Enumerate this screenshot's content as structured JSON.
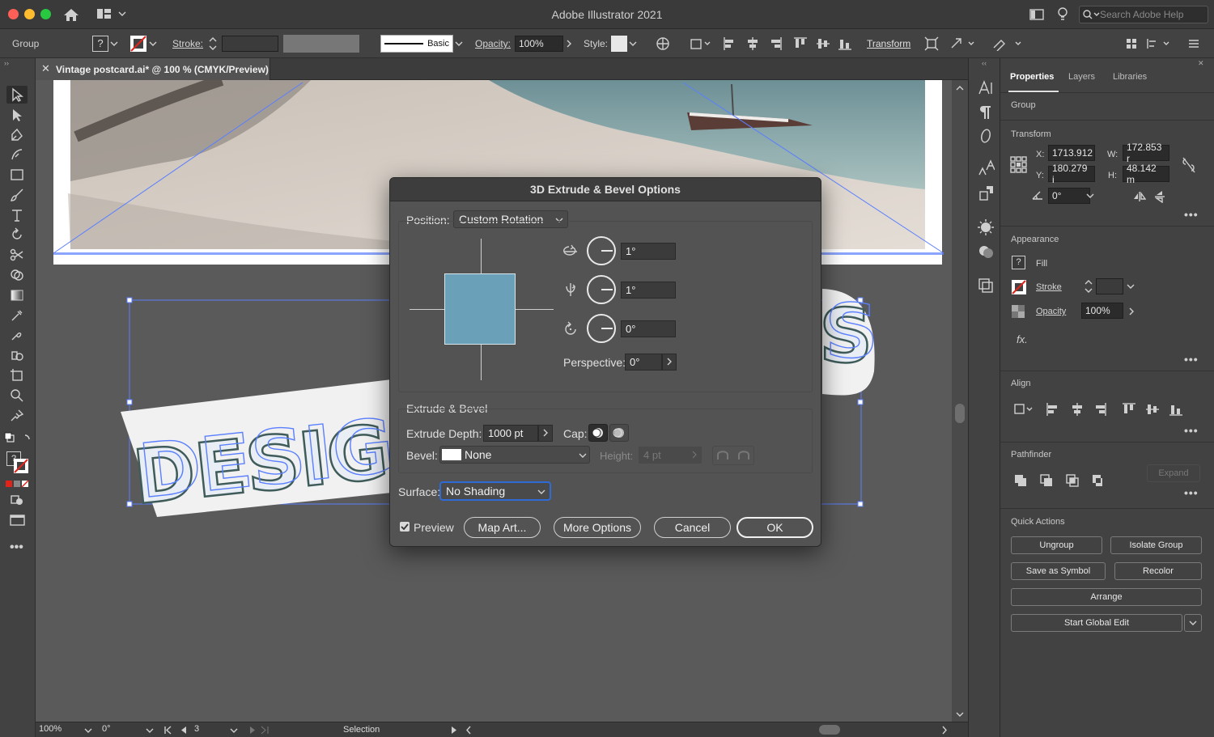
{
  "window": {
    "title": "Adobe Illustrator 2021",
    "search_placeholder": "Search Adobe Help"
  },
  "control_bar": {
    "selection_type": "Group",
    "stroke_label": "Stroke:",
    "stroke_style": "Basic",
    "opacity_label": "Opacity:",
    "opacity_value": "100%",
    "style_label": "Style:",
    "transform_label": "Transform"
  },
  "document_tab": {
    "label": "Vintage postcard.ai* @ 100 % (CMYK/Preview)"
  },
  "artwork": {
    "design_text": "DESIG",
    "trailing_text": "S"
  },
  "status_bar": {
    "zoom": "100%",
    "rotation": "0°",
    "artboard": "3",
    "tool": "Selection"
  },
  "panel": {
    "tabs": [
      "Properties",
      "Layers",
      "Libraries"
    ],
    "group_label": "Group",
    "transform": {
      "title": "Transform",
      "x_label": "X:",
      "x": "1713.912",
      "y_label": "Y:",
      "y": "180.279 i",
      "w_label": "W:",
      "w": "172.853 r",
      "h_label": "H:",
      "h": "48.142 m",
      "angle": "0°"
    },
    "appearance": {
      "title": "Appearance",
      "fill": "Fill",
      "stroke": "Stroke",
      "opacity_label": "Opacity",
      "opacity": "100%"
    },
    "align_title": "Align",
    "pathfinder": {
      "title": "Pathfinder",
      "expand": "Expand"
    },
    "quick_actions": {
      "title": "Quick Actions",
      "ungroup": "Ungroup",
      "isolate": "Isolate Group",
      "symbol": "Save as Symbol",
      "recolor": "Recolor",
      "arrange": "Arrange",
      "global_edit": "Start Global Edit"
    }
  },
  "dialog": {
    "title": "3D Extrude & Bevel Options",
    "position_label": "Position:",
    "position_value": "Custom Rotation",
    "rot_x": "1°",
    "rot_y": "1°",
    "rot_z": "0°",
    "perspective_label": "Perspective:",
    "perspective": "0°",
    "extrude_title": "Extrude & Bevel",
    "depth_label": "Extrude Depth:",
    "depth": "1000 pt",
    "cap_label": "Cap:",
    "bevel_label": "Bevel:",
    "bevel_value": "None",
    "height_label": "Height:",
    "height_value": "4 pt",
    "surface_label": "Surface:",
    "surface_value": "No Shading",
    "preview_label": "Preview",
    "buttons": {
      "map_art": "Map Art...",
      "more": "More Options",
      "cancel": "Cancel",
      "ok": "OK"
    }
  },
  "colors": {
    "accent_blue": "#2e6bd6",
    "cube_face": "#6aa1b9",
    "selection": "#5a7fff"
  }
}
